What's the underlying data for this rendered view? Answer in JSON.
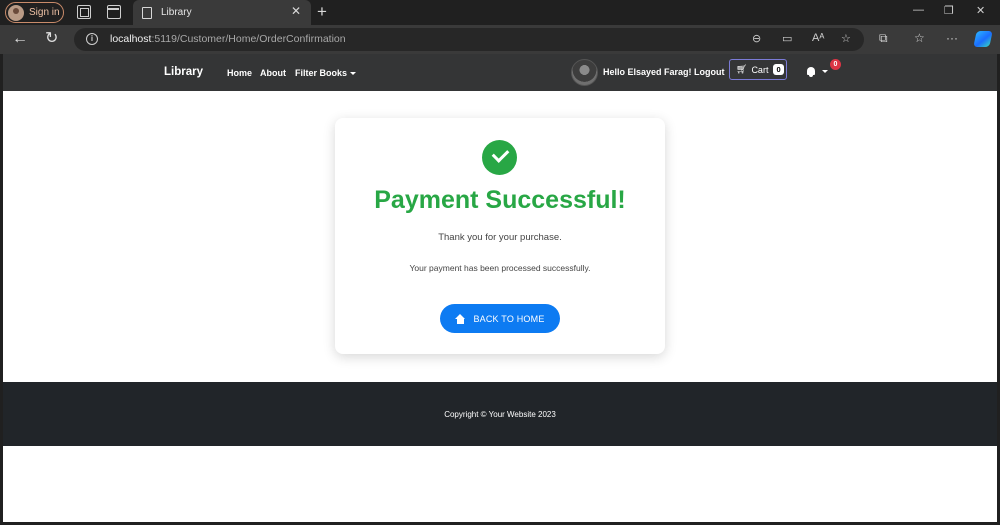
{
  "browser": {
    "signin_label": "Sign in",
    "tab_title": "Library",
    "url_host": "localhost",
    "url_path": ":5119/Customer/Home/OrderConfirmation"
  },
  "navbar": {
    "brand": "Library",
    "links": [
      "Home",
      "About",
      "Filter Books"
    ],
    "greeting": "Hello Elsayed Farag!",
    "logout": "Logout",
    "cart_label": "Cart",
    "cart_count": "0",
    "notification_count": "0"
  },
  "confirmation": {
    "title": "Payment Successful!",
    "thanks": "Thank you for your purchase.",
    "processed": "Your payment has been processed successfully.",
    "button_label": "BACK TO HOME"
  },
  "footer": {
    "copyright": "Copyright © Your Website 2023"
  },
  "colors": {
    "success": "#28a745",
    "primary": "#0d7bf2",
    "navbar": "#343536",
    "footer": "#212529",
    "badge": "#dc3545"
  }
}
